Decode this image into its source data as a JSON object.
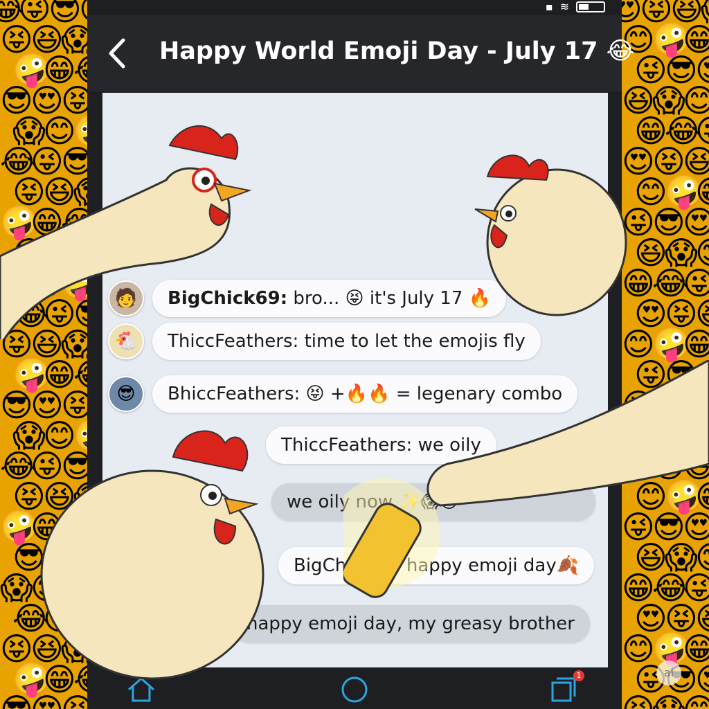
{
  "header": {
    "back_icon": "chevron-left-icon",
    "title": "Happy World Emoji Day - July 17 😂"
  },
  "messages": [
    {
      "user": "BigChick69:",
      "text": " bro... 😝 it's July 17 🔥",
      "avatar": "🧑",
      "style": "bold"
    },
    {
      "user": "ThiccFeathers:",
      "text": " time to let the emojis fly",
      "avatar": "🐔",
      "style": "plain"
    },
    {
      "user": "BhiccFeathers:",
      "text": " 😝 +🔥🔥 = legenary combo",
      "avatar": "😎",
      "style": "plain"
    },
    {
      "user": "ThiccFeathers:",
      "text": " we oily",
      "avatar": "",
      "style": "plain"
    },
    {
      "user": "",
      "text": "we oily now ✨😱😊",
      "avatar": "",
      "style": "grey"
    },
    {
      "user": "BigChick69:",
      "text": "  happy emoji day🍂",
      "avatar": "",
      "style": "plain"
    },
    {
      "user": "",
      "text": "happy emoji day, my greasy brother",
      "avatar": "",
      "style": "grey"
    }
  ],
  "navbar": {
    "home_icon": "home-icon",
    "circle_icon": "home-circle-icon",
    "recents_icon": "recents-icon",
    "recents_badge": "1"
  },
  "watermark": "ai",
  "colors": {
    "header_bg": "#26272b",
    "chat_bg": "#e7ebf2",
    "wall": "#f0b400",
    "accent": "#2aa7e0"
  }
}
